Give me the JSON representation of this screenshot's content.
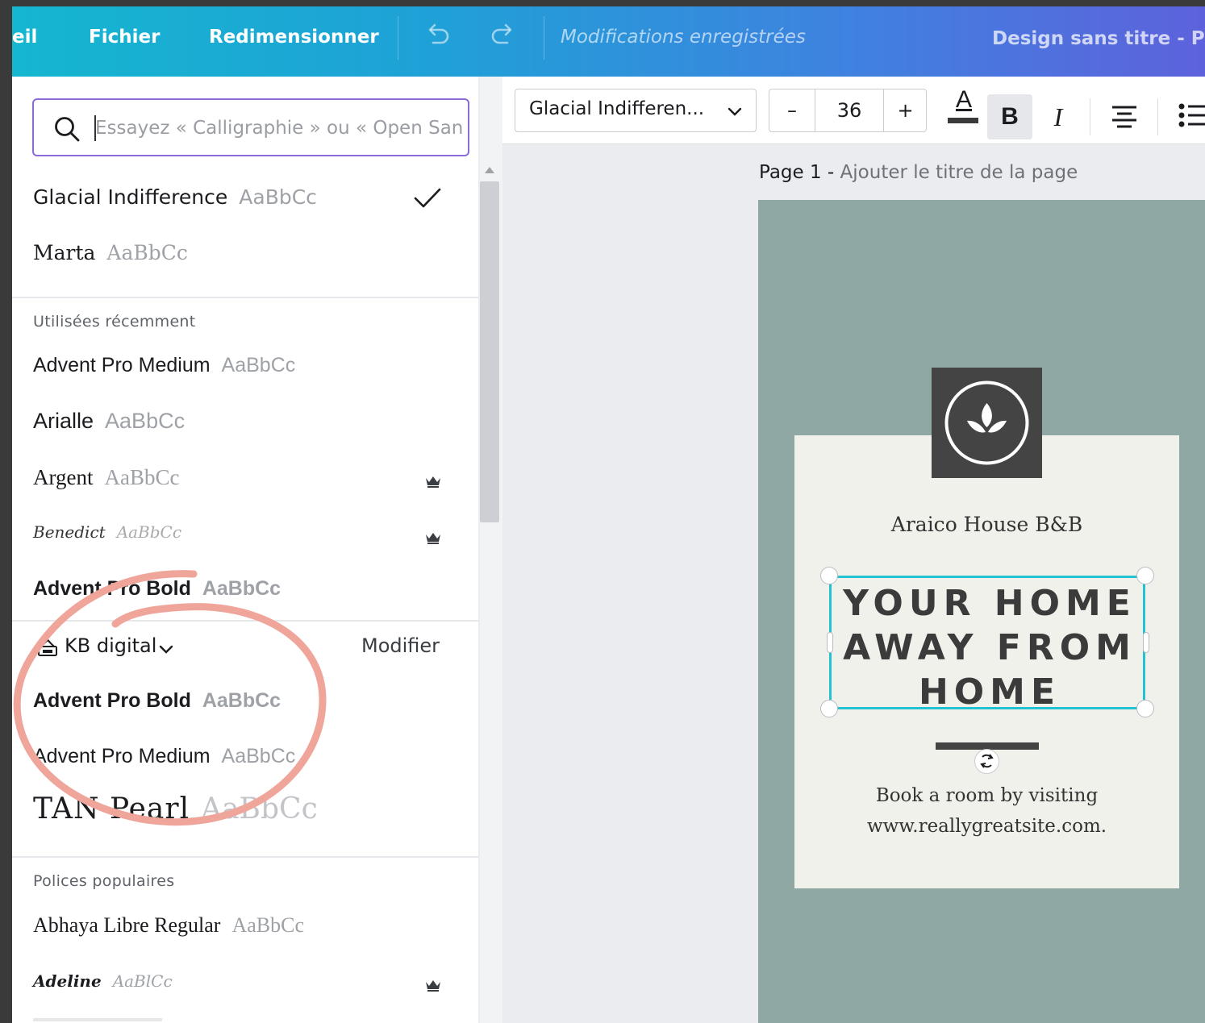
{
  "topbar": {
    "home_partial": "eil",
    "file": "Fichier",
    "resize": "Redimensionner",
    "save_status": "Modifications enregistrées",
    "design_title": "Design sans titre - Publ"
  },
  "search": {
    "placeholder": "Essayez « Calligraphie » ou « Open San"
  },
  "current_fonts": [
    {
      "name": "Glacial Indifference",
      "sample": "AaBbCc",
      "selected": true
    },
    {
      "name": "Marta",
      "sample": "AaBbCc"
    }
  ],
  "recent": {
    "label": "Utilisées récemment",
    "fonts": [
      {
        "name": "Advent Pro Medium",
        "sample": "AaBbCc"
      },
      {
        "name": "Arialle",
        "sample": "AaBbCc"
      },
      {
        "name": "Argent",
        "sample": "AaBbCc",
        "premium": true
      },
      {
        "name": "Benedict",
        "sample": "AaBbCc",
        "premium": true
      },
      {
        "name": "Advent Pro Bold",
        "sample": "AaBbCc"
      }
    ]
  },
  "brand_kit": {
    "name": "KB digital",
    "edit": "Modifier",
    "fonts": [
      {
        "name": "Advent Pro Bold",
        "sample": "AaBbCc"
      },
      {
        "name": "Advent Pro Medium",
        "sample": "AaBbCc"
      },
      {
        "name": "TAN Pearl",
        "sample": "AaBbCc"
      }
    ]
  },
  "popular": {
    "label": "Polices populaires",
    "fonts": [
      {
        "name": "Abhaya Libre Regular",
        "sample": "AaBbCc"
      },
      {
        "name": "Adeline",
        "sample": "AaBlCc",
        "premium": true
      }
    ]
  },
  "toolbar": {
    "font_name": "Glacial Indifferen...",
    "minus": "–",
    "font_size": "36",
    "plus": "+",
    "text_color_letter": "A",
    "bold": "B",
    "italic": "I"
  },
  "canvas": {
    "page_number": "Page 1",
    "page_sep": " - ",
    "page_title_placeholder": "Ajouter le titre de la page",
    "business_name": "Araico House B&B",
    "headline_lines": [
      "YOUR HOME",
      "AWAY FROM",
      "HOME"
    ],
    "visit_line1": "Book a room by visiting",
    "visit_line2": "www.reallygreatsite.com."
  },
  "colors": {
    "topbar_start": "#15b6cf",
    "topbar_end": "#5d62dc",
    "search_border": "#8b6bd8",
    "page_bg": "#8fa8a3",
    "card_bg": "#f1f1ec",
    "selection": "#23c1d2",
    "annotation": "#f0a59a"
  }
}
